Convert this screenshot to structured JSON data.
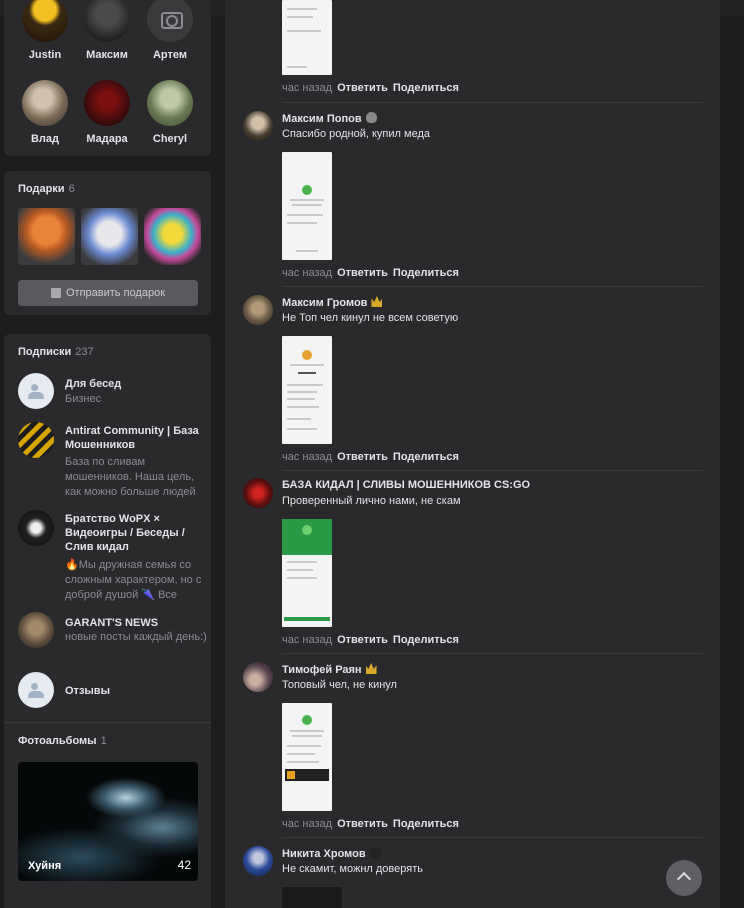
{
  "friends": [
    {
      "name": "Justin",
      "icon": "friend-avatar"
    },
    {
      "name": "Максим",
      "icon": "friend-avatar"
    },
    {
      "name": "Артем",
      "icon": "camera-icon"
    },
    {
      "name": "Влад",
      "icon": "friend-avatar"
    },
    {
      "name": "Мадара",
      "icon": "friend-avatar"
    },
    {
      "name": "Cheryl",
      "icon": "friend-avatar"
    }
  ],
  "gifts": {
    "title": "Подарки",
    "count": "6",
    "button_label": "Отправить подарок",
    "button_icon": "gift-icon"
  },
  "subscriptions": {
    "title": "Подписки",
    "count": "237",
    "items": [
      {
        "name": "Для бесед",
        "desc": "Бизнес"
      },
      {
        "name": "Antirat Community | База Мошенников",
        "desc": "База по сливам мошенников. Наша цель, как можно больше людей"
      },
      {
        "name": "Братство WoPX × Видеоигры / Беседы / Слив кидал",
        "desc": "🔥Мы дружная семья со сложным характером, но с доброй душой 🌂 Все"
      },
      {
        "name": "GARANT'S NEWS",
        "desc": "новые посты каждый день:)"
      },
      {
        "name": "Отзывы",
        "desc": ""
      }
    ]
  },
  "albums": {
    "title": "Фотоальбомы",
    "count": "1",
    "items": [
      {
        "name": "Хуйня",
        "count": "42"
      }
    ]
  },
  "comments": [
    {
      "name": "",
      "text": "",
      "time": "час назад"
    },
    {
      "name": "Максим Попов",
      "text": "Спасибо родной, купил меда",
      "time": "час назад",
      "badge": "blob"
    },
    {
      "name": "Максим Громов",
      "text": "Не Топ чел кинул не всем советую",
      "time": "час назад",
      "badge": "crown"
    },
    {
      "name": "БАЗА КИДАЛ | СЛИВЫ МОШЕННИКОВ CS:GO",
      "text": "Проверенный лично нами, не скам",
      "time": "час назад"
    },
    {
      "name": "Тимофей Раян",
      "text": "Топовый чел, не кинул",
      "time": "час назад",
      "badge": "crown"
    },
    {
      "name": "Никита Хромов",
      "text": "Не скамит, можнл доверять",
      "time": "",
      "badge": "blob"
    }
  ],
  "actions": {
    "reply": "Ответить",
    "share": "Поделиться"
  },
  "colors": {
    "background": "#1c1c1e",
    "card": "#2a2a2c",
    "muted": "#8a8c90",
    "text": "#e1e3e6",
    "crown": "#d8a82a"
  }
}
